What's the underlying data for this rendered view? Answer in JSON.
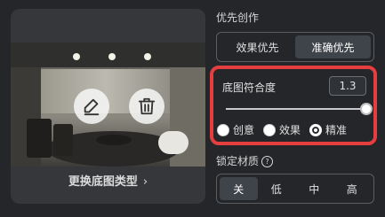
{
  "image_card": {
    "change_type_label": "更换底图类型",
    "chevron": "›",
    "edit_icon": "pencil-icon",
    "delete_icon": "trash-icon"
  },
  "priority": {
    "title": "优先创作",
    "options": [
      "效果优先",
      "准确优先"
    ],
    "selected": "准确优先"
  },
  "conformity": {
    "label": "底图符合度",
    "value": "1.3",
    "slider_fraction": 1.0,
    "modes": [
      "创意",
      "效果",
      "精准"
    ],
    "selected_mode": "精准"
  },
  "material_lock": {
    "title": "锁定材质",
    "help": "?",
    "options": [
      "关",
      "低",
      "中",
      "高"
    ],
    "selected": "关"
  },
  "colors": {
    "highlight_border": "#e53e3e",
    "background": "#242629"
  }
}
